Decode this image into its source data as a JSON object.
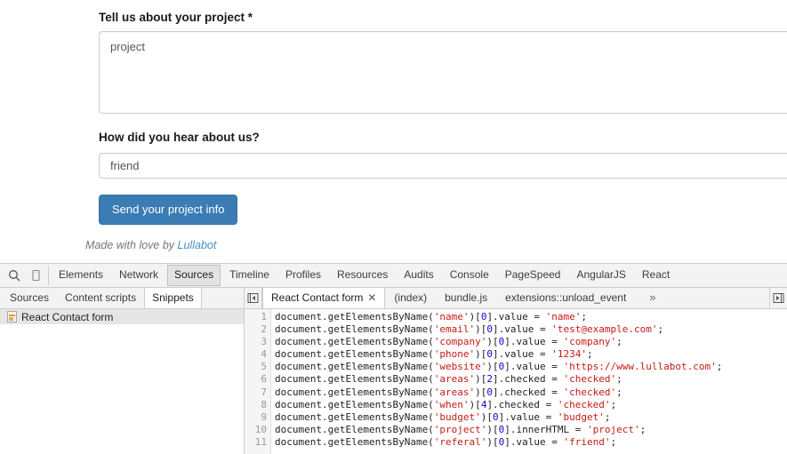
{
  "page": {
    "fields": [
      {
        "id": "project",
        "label": "Tell us about your project *",
        "value": "project",
        "type": "textarea"
      },
      {
        "id": "referal",
        "label": "How did you hear about us?",
        "value": "friend",
        "type": "text"
      }
    ],
    "submit_label": "Send your project info",
    "credit_prefix": "Made with love by ",
    "credit_link": "Lullabot"
  },
  "devtools": {
    "toolbar": {
      "search_icon": "search-icon",
      "device_icon": "device-toggle-icon",
      "panels": [
        {
          "label": "Elements",
          "active": false
        },
        {
          "label": "Network",
          "active": false
        },
        {
          "label": "Sources",
          "active": true
        },
        {
          "label": "Timeline",
          "active": false
        },
        {
          "label": "Profiles",
          "active": false
        },
        {
          "label": "Resources",
          "active": false
        },
        {
          "label": "Audits",
          "active": false
        },
        {
          "label": "Console",
          "active": false
        },
        {
          "label": "PageSpeed",
          "active": false
        },
        {
          "label": "AngularJS",
          "active": false
        },
        {
          "label": "React",
          "active": false
        }
      ]
    },
    "nav": {
      "tabs": [
        {
          "label": "Sources",
          "active": false
        },
        {
          "label": "Content scripts",
          "active": false
        },
        {
          "label": "Snippets",
          "active": true
        }
      ],
      "items": [
        {
          "label": "React Contact form",
          "icon": "snippet-file-icon",
          "selected": true
        }
      ]
    },
    "editor": {
      "scroll_left_icon": "tab-scroll-left-icon",
      "scroll_right_icon": "tab-scroll-right-icon",
      "overflow_label": "»",
      "tabs": [
        {
          "label": "React Contact form",
          "active": true,
          "closable": true,
          "close_label": "✕"
        },
        {
          "label": "(index)",
          "active": false,
          "closable": false
        },
        {
          "label": "bundle.js",
          "active": false,
          "closable": false
        },
        {
          "label": "extensions::unload_event",
          "active": false,
          "closable": false
        }
      ],
      "line_numbers": [
        "1",
        "2",
        "3",
        "4",
        "5",
        "6",
        "7",
        "8",
        "9",
        "10",
        "11"
      ],
      "code_lines": [
        [
          [
            "document.getElementsByName(",
            "p"
          ],
          [
            "'name'",
            "s"
          ],
          [
            ")[",
            "p"
          ],
          [
            "0",
            "n"
          ],
          [
            "].value = ",
            "p"
          ],
          [
            "'name'",
            "s"
          ],
          [
            ";",
            "p"
          ]
        ],
        [
          [
            "document.getElementsByName(",
            "p"
          ],
          [
            "'email'",
            "s"
          ],
          [
            ")[",
            "p"
          ],
          [
            "0",
            "n"
          ],
          [
            "].value = ",
            "p"
          ],
          [
            "'test@example.com'",
            "s"
          ],
          [
            ";",
            "p"
          ]
        ],
        [
          [
            "document.getElementsByName(",
            "p"
          ],
          [
            "'company'",
            "s"
          ],
          [
            ")[",
            "p"
          ],
          [
            "0",
            "n"
          ],
          [
            "].value = ",
            "p"
          ],
          [
            "'company'",
            "s"
          ],
          [
            ";",
            "p"
          ]
        ],
        [
          [
            "document.getElementsByName(",
            "p"
          ],
          [
            "'phone'",
            "s"
          ],
          [
            ")[",
            "p"
          ],
          [
            "0",
            "n"
          ],
          [
            "].value = ",
            "p"
          ],
          [
            "'1234'",
            "s"
          ],
          [
            ";",
            "p"
          ]
        ],
        [
          [
            "document.getElementsByName(",
            "p"
          ],
          [
            "'website'",
            "s"
          ],
          [
            ")[",
            "p"
          ],
          [
            "0",
            "n"
          ],
          [
            "].value = ",
            "p"
          ],
          [
            "'https://www.lullabot.com'",
            "s"
          ],
          [
            ";",
            "p"
          ]
        ],
        [
          [
            "document.getElementsByName(",
            "p"
          ],
          [
            "'areas'",
            "s"
          ],
          [
            ")[",
            "p"
          ],
          [
            "2",
            "n"
          ],
          [
            "].checked = ",
            "p"
          ],
          [
            "'checked'",
            "s"
          ],
          [
            ";",
            "p"
          ]
        ],
        [
          [
            "document.getElementsByName(",
            "p"
          ],
          [
            "'areas'",
            "s"
          ],
          [
            ")[",
            "p"
          ],
          [
            "0",
            "n"
          ],
          [
            "].checked = ",
            "p"
          ],
          [
            "'checked'",
            "s"
          ],
          [
            ";",
            "p"
          ]
        ],
        [
          [
            "document.getElementsByName(",
            "p"
          ],
          [
            "'when'",
            "s"
          ],
          [
            ")[",
            "p"
          ],
          [
            "4",
            "n"
          ],
          [
            "].checked = ",
            "p"
          ],
          [
            "'checked'",
            "s"
          ],
          [
            ";",
            "p"
          ]
        ],
        [
          [
            "document.getElementsByName(",
            "p"
          ],
          [
            "'budget'",
            "s"
          ],
          [
            ")[",
            "p"
          ],
          [
            "0",
            "n"
          ],
          [
            "].value = ",
            "p"
          ],
          [
            "'budget'",
            "s"
          ],
          [
            ";",
            "p"
          ]
        ],
        [
          [
            "document.getElementsByName(",
            "p"
          ],
          [
            "'project'",
            "s"
          ],
          [
            ")[",
            "p"
          ],
          [
            "0",
            "n"
          ],
          [
            "].innerHTML = ",
            "p"
          ],
          [
            "'project'",
            "s"
          ],
          [
            ";",
            "p"
          ]
        ],
        [
          [
            "document.getElementsByName(",
            "p"
          ],
          [
            "'referal'",
            "s"
          ],
          [
            ")[",
            "p"
          ],
          [
            "0",
            "n"
          ],
          [
            "].value = ",
            "p"
          ],
          [
            "'friend'",
            "s"
          ],
          [
            ";",
            "p"
          ]
        ]
      ]
    }
  },
  "colors": {
    "button_blue": "#3b7cb5",
    "link_blue": "#4a8fc4",
    "string_red": "#c41a16",
    "number_blue": "#1c00cf",
    "devtools_bg": "#f3f3f3"
  }
}
